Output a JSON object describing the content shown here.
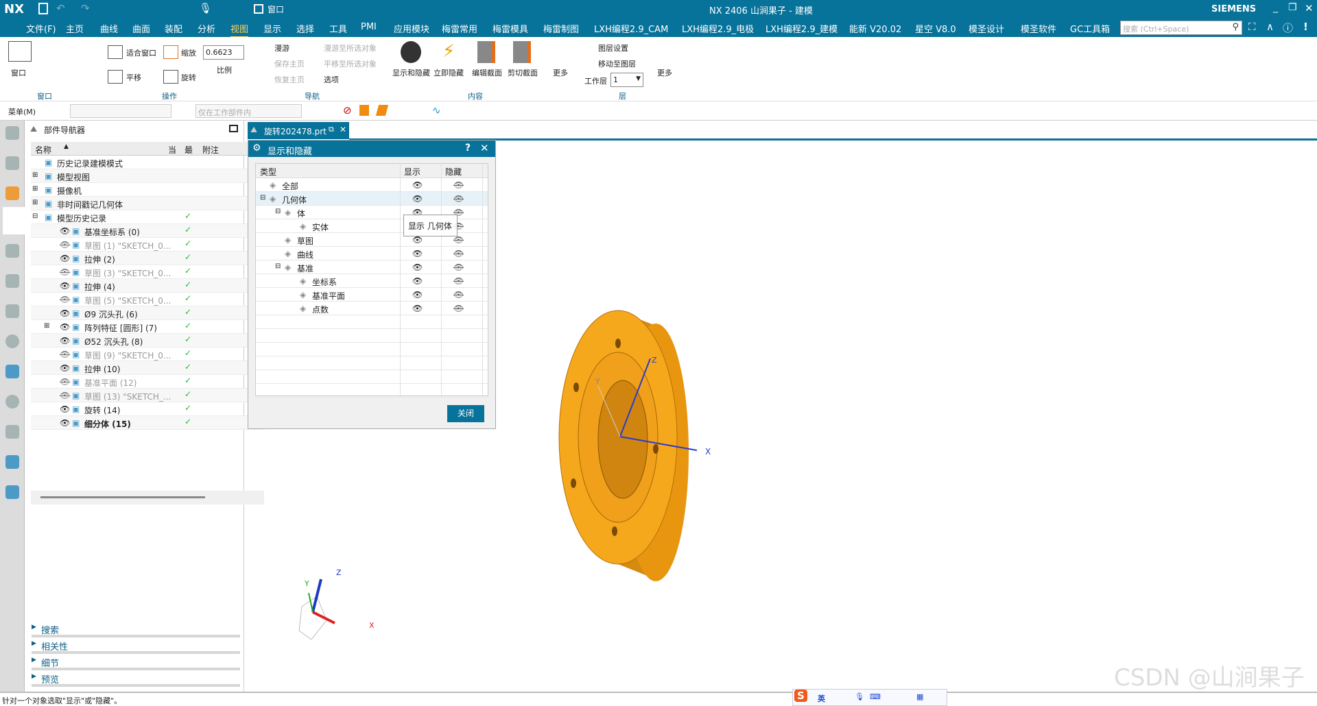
{
  "titlebar": {
    "logo": "NX",
    "title": "NX 2406 山涧果子 - 建模",
    "brand": "SIEMENS",
    "window_menu": "窗口",
    "colors": {
      "bar": "#07729a"
    }
  },
  "menubar": {
    "items": [
      "文件(F)",
      "主页",
      "曲线",
      "曲面",
      "装配",
      "分析",
      "视图",
      "显示",
      "选择",
      "工具",
      "PMI",
      "应用模块",
      "梅雷常用",
      "梅雷模具",
      "梅雷制图",
      "LXH编程2.9_CAM",
      "LXH编程2.9_电极",
      "LXH编程2.9_建模",
      "能新 V20.02",
      "星空 V8.0",
      "模圣设计",
      "模圣软件",
      "GC工具箱"
    ],
    "active": "视图",
    "search_placeholder": "搜索 (Ctrl+Space)"
  },
  "ribbon": {
    "window_group": {
      "label": "窗口",
      "button": "窗口"
    },
    "operate_group": {
      "label": "操作",
      "fit": "适合窗口",
      "zoom": "缩放",
      "scale_value": "0.6623",
      "scale_label": "比例",
      "pan": "平移",
      "rotate": "旋转"
    },
    "nav_group": {
      "label": "导航",
      "fly": "漫游",
      "fly_to": "漫游至所选对象",
      "save_home": "保存主页",
      "pan_to": "平移至所选对象",
      "restore_home": "恢复主页",
      "options": "选项"
    },
    "content_group": {
      "label": "内容",
      "show_hide": "显示和隐藏",
      "immediate_hide": "立即隐藏",
      "edit_section": "编辑截面",
      "clip_section": "剪切截面",
      "more": "更多"
    },
    "layer_group": {
      "label": "层",
      "layer_settings": "图层设置",
      "move_to_layer": "移动至图层",
      "work_layer_label": "工作层",
      "work_layer_value": "1",
      "more": "更多"
    }
  },
  "cmdbar": {
    "menu": "菜单(M)",
    "filter_value": "",
    "scope_value": "仅在工作部件内"
  },
  "navigator": {
    "title": "部件导航器",
    "columns": [
      "名称",
      "当",
      "最",
      "附注"
    ],
    "rows": [
      {
        "name": "历史记录建模模式",
        "dim": false,
        "check": false,
        "indent": 0
      },
      {
        "name": "模型视图",
        "dim": false,
        "check": false,
        "indent": 0,
        "expand": "+"
      },
      {
        "name": "摄像机",
        "dim": false,
        "check": false,
        "indent": 0,
        "expand": "+"
      },
      {
        "name": "非时间戳记几何体",
        "dim": false,
        "check": false,
        "indent": 0,
        "expand": "+"
      },
      {
        "name": "模型历史记录",
        "dim": false,
        "check": true,
        "indent": 0,
        "expand": "-"
      },
      {
        "name": "基准坐标系 (0)",
        "dim": false,
        "check": true,
        "indent": 1,
        "eye": "show"
      },
      {
        "name": "草图 (1) \"SKETCH_0...",
        "dim": true,
        "check": true,
        "indent": 1,
        "eye": "hide"
      },
      {
        "name": "拉伸 (2)",
        "dim": false,
        "check": true,
        "indent": 1,
        "eye": "show"
      },
      {
        "name": "草图 (3) \"SKETCH_0...",
        "dim": true,
        "check": true,
        "indent": 1,
        "eye": "hide"
      },
      {
        "name": "拉伸 (4)",
        "dim": false,
        "check": true,
        "indent": 1,
        "eye": "show"
      },
      {
        "name": "草图 (5) \"SKETCH_0...",
        "dim": true,
        "check": true,
        "indent": 1,
        "eye": "hide"
      },
      {
        "name": "Ø9 沉头孔 (6)",
        "dim": false,
        "check": true,
        "indent": 1,
        "eye": "show"
      },
      {
        "name": "阵列特征 [圆形] (7)",
        "dim": false,
        "check": true,
        "indent": 1,
        "eye": "show",
        "expand": "+"
      },
      {
        "name": "Ø52 沉头孔 (8)",
        "dim": false,
        "check": true,
        "indent": 1,
        "eye": "show"
      },
      {
        "name": "草图 (9) \"SKETCH_0...",
        "dim": true,
        "check": true,
        "indent": 1,
        "eye": "hide"
      },
      {
        "name": "拉伸 (10)",
        "dim": false,
        "check": true,
        "indent": 1,
        "eye": "show"
      },
      {
        "name": "基准平面 (12)",
        "dim": true,
        "check": true,
        "indent": 1,
        "eye": "hide"
      },
      {
        "name": "草图 (13) \"SKETCH_...",
        "dim": true,
        "check": true,
        "indent": 1,
        "eye": "hide"
      },
      {
        "name": "旋转 (14)",
        "dim": false,
        "check": true,
        "indent": 1,
        "eye": "show"
      },
      {
        "name": "细分体 (15)",
        "dim": false,
        "check": true,
        "indent": 1,
        "eye": "show",
        "bold": true
      }
    ],
    "sections": [
      "搜索",
      "相关性",
      "细节",
      "预览"
    ]
  },
  "tab": {
    "label": "旋转202478.prt"
  },
  "dialog": {
    "title": "显示和隐藏",
    "help": "?",
    "columns": [
      "类型",
      "显示",
      "隐藏"
    ],
    "rows": [
      {
        "type": "全部",
        "indent": 0
      },
      {
        "type": "几何体",
        "indent": 0,
        "expand": "-",
        "selected": true
      },
      {
        "type": "体",
        "indent": 1,
        "expand": "-"
      },
      {
        "type": "实体",
        "indent": 2
      },
      {
        "type": "草图",
        "indent": 1
      },
      {
        "type": "曲线",
        "indent": 1
      },
      {
        "type": "基准",
        "indent": 1,
        "expand": "-"
      },
      {
        "type": "坐标系",
        "indent": 2
      },
      {
        "type": "基准平面",
        "indent": 2
      },
      {
        "type": "点数",
        "indent": 2
      }
    ],
    "tooltip": "显示 几何体",
    "close": "关闭"
  },
  "viewport": {
    "axis_labels": [
      "X",
      "Y",
      "Z"
    ],
    "model_color": "#f0a01a",
    "watermark": "CSDN @山涧果子"
  },
  "status": {
    "message": "针对一个对象选取\"显示\"或\"隐藏\"。",
    "ime": "英"
  }
}
